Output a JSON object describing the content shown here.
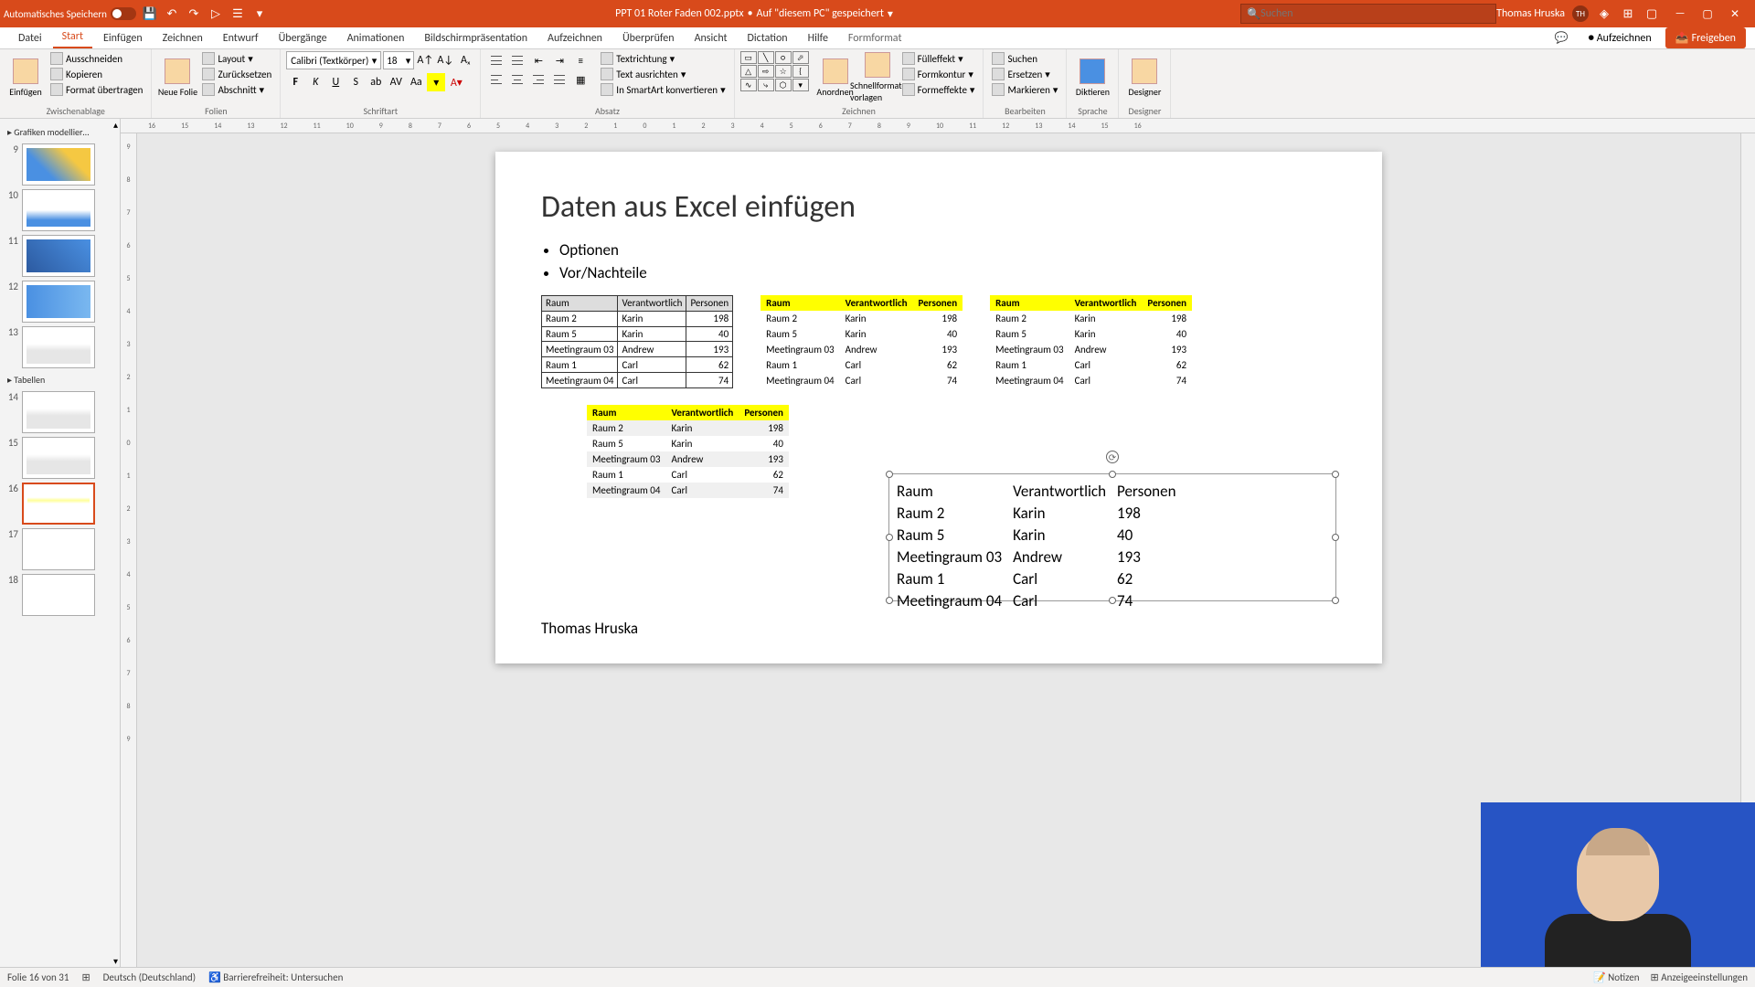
{
  "titlebar": {
    "autosave_label": "Automatisches Speichern",
    "doc_name": "PPT 01 Roter Faden 002.pptx",
    "saved_hint": "Auf \"diesem PC\" gespeichert",
    "search_placeholder": "Suchen",
    "user_name": "Thomas Hruska",
    "user_initials": "TH"
  },
  "tabs": {
    "datei": "Datei",
    "start": "Start",
    "einfugen": "Einfügen",
    "zeichnen": "Zeichnen",
    "entwurf": "Entwurf",
    "ubergange": "Übergänge",
    "animationen": "Animationen",
    "bildschirm": "Bildschirmpräsentation",
    "aufzeichnen_tab": "Aufzeichnen",
    "uberprufen": "Überprüfen",
    "ansicht": "Ansicht",
    "dictation": "Dictation",
    "hilfe": "Hilfe",
    "formformat": "Formformat",
    "aufzeichnen_btn": "Aufzeichnen",
    "freigeben": "Freigeben"
  },
  "ribbon": {
    "einfugen_btn": "Einfügen",
    "ausschneiden": "Ausschneiden",
    "kopieren": "Kopieren",
    "format_ubertragen": "Format übertragen",
    "zwischenablage": "Zwischenablage",
    "neue_folie": "Neue Folie",
    "layout": "Layout",
    "zurucksetzen": "Zurücksetzen",
    "abschnitt": "Abschnitt",
    "folien": "Folien",
    "font_name": "Calibri (Textkörper)",
    "font_size": "18",
    "schriftart": "Schriftart",
    "absatz": "Absatz",
    "textrichtung": "Textrichtung",
    "text_ausrichten": "Text ausrichten",
    "smartart": "In SmartArt konvertieren",
    "anordnen": "Anordnen",
    "schnellformat": "Schnellformat-vorlagen",
    "fulleffekt": "Fülleffekt",
    "formkontur": "Formkontur",
    "formeffekte": "Formeffekte",
    "zeichnen_grp": "Zeichnen",
    "suchen": "Suchen",
    "ersetzen": "Ersetzen",
    "markieren": "Markieren",
    "bearbeiten": "Bearbeiten",
    "diktieren": "Diktieren",
    "sprache": "Sprache",
    "designer": "Designer",
    "designer_grp": "Designer"
  },
  "thumbs": {
    "section1": "Grafiken modellier…",
    "section2": "Tabellen",
    "nums": [
      "9",
      "10",
      "11",
      "12",
      "13",
      "14",
      "15",
      "16",
      "17",
      "18"
    ]
  },
  "slide": {
    "title": "Daten aus Excel einfügen",
    "bullet1": "Optionen",
    "bullet2": "Vor/Nachteile",
    "footer": "Thomas Hruska",
    "headers": {
      "raum": "Raum",
      "verantwortlich": "Verantwortlich",
      "personen": "Personen"
    },
    "rows": [
      {
        "raum": "Raum 2",
        "ver": "Karin",
        "pers": "198"
      },
      {
        "raum": "Raum 5",
        "ver": "Karin",
        "pers": "40"
      },
      {
        "raum": "Meetingraum 03",
        "ver": "Andrew",
        "pers": "193"
      },
      {
        "raum": "Raum 1",
        "ver": "Carl",
        "pers": "62"
      },
      {
        "raum": "Meetingraum 04",
        "ver": "Carl",
        "pers": "74"
      }
    ]
  },
  "status": {
    "folie": "Folie 16 von 31",
    "lang": "Deutsch (Deutschland)",
    "barrier": "Barrierefreiheit: Untersuchen",
    "notizen": "Notizen",
    "anzeige": "Anzeigeeinstellungen"
  }
}
